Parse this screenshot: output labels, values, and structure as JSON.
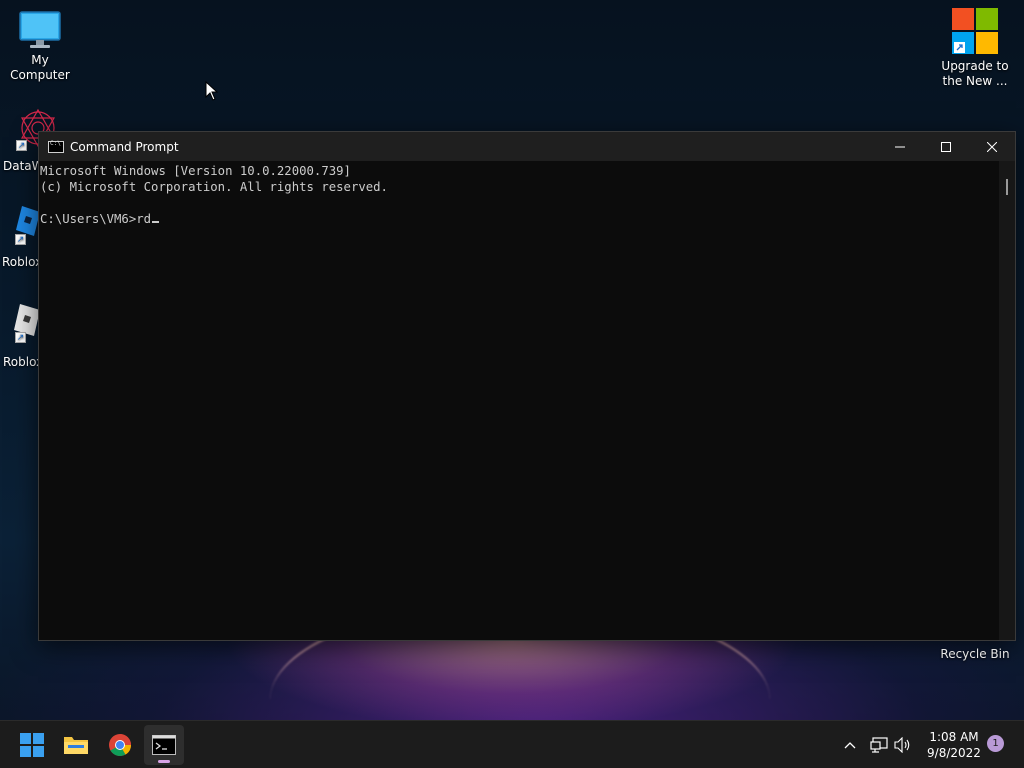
{
  "desktop": {
    "icons": [
      {
        "label": "My Computer"
      },
      {
        "label": "DataW"
      },
      {
        "label": "Roblox"
      },
      {
        "label": "Roblox"
      },
      {
        "label": "Upgrade to the New ..."
      }
    ],
    "recycle_bin_label": "Recycle Bin"
  },
  "cmd_window": {
    "title": "Command Prompt",
    "console_lines": [
      "Microsoft Windows [Version 10.0.22000.739]",
      "(c) Microsoft Corporation. All rights reserved.",
      "",
      "C:\\Users\\VM6>rd"
    ],
    "minimize_icon": "minimize-icon",
    "maximize_icon": "maximize-icon",
    "close_icon": "close-icon"
  },
  "taskbar": {
    "apps": [
      {
        "name": "start-button",
        "icon": "windows-logo-icon"
      },
      {
        "name": "file-explorer",
        "icon": "folder-icon"
      },
      {
        "name": "google-chrome",
        "icon": "chrome-icon"
      },
      {
        "name": "command-prompt",
        "icon": "terminal-icon",
        "active": true
      }
    ],
    "tray": {
      "chevron": "chevron-up-icon",
      "network": "network-icon",
      "volume": "volume-icon"
    },
    "clock": {
      "time": "1:08 AM",
      "date": "9/8/2022"
    },
    "notification_count": "1"
  },
  "colors": {
    "console_bg": "#0c0c0c",
    "console_text": "#cccccc",
    "titlebar": "#1f1f1f",
    "taskbar": "#1c1c1c",
    "active_indicator": "#d8a3e6",
    "ms_red": "#f25022",
    "ms_green": "#7fba00",
    "ms_blue": "#00a4ef",
    "ms_yellow": "#ffb900"
  }
}
